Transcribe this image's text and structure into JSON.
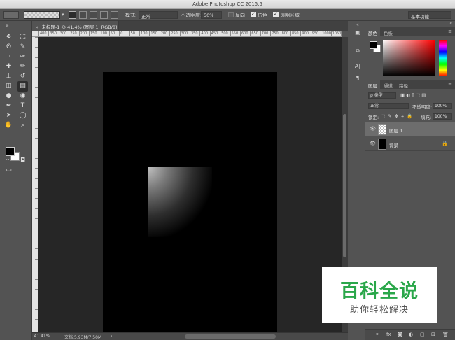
{
  "window": {
    "title": "Adobe Photoshop CC 2015.5"
  },
  "options_bar": {
    "mode_label": "模式:",
    "mode_value": "正常",
    "opacity_label": "不透明度:",
    "opacity_value": "50%",
    "reverse_label": "反向",
    "dither_label": "仿色",
    "transparency_label": "透明区域",
    "workspace_value": "基本功能",
    "reverse_checked": false,
    "dither_checked": true,
    "transparency_checked": true
  },
  "document_tab": {
    "close": "×",
    "label": "未标题-1 @ 41.4% (图层 1, RGB/8) *"
  },
  "ruler_top": {
    "labels": [
      "400",
      "350",
      "300",
      "250",
      "200",
      "150",
      "100",
      "50",
      "0",
      "50",
      "100",
      "150",
      "200",
      "250",
      "300",
      "350",
      "400",
      "450",
      "500",
      "550",
      "600",
      "650",
      "700",
      "750",
      "800",
      "850",
      "900",
      "950",
      "1000",
      "1050",
      "1100"
    ]
  },
  "status_bar": {
    "zoom": "41.41%",
    "doc_info": "文档:5.93M/7.50M",
    "arrow": "›"
  },
  "toolbar": {
    "collapse": "»",
    "tools": [
      {
        "icon": "✥",
        "name": "move-tool-icon"
      },
      {
        "icon": "⬚",
        "name": "marquee-tool-icon"
      },
      {
        "icon": "ʘ",
        "name": "lasso-tool-icon"
      },
      {
        "icon": "✎",
        "name": "quick-selection-tool-icon"
      },
      {
        "icon": "⌗",
        "name": "crop-tool-icon"
      },
      {
        "icon": "✑",
        "name": "eyedropper-tool-icon"
      },
      {
        "icon": "✚",
        "name": "healing-brush-tool-icon"
      },
      {
        "icon": "✏",
        "name": "brush-tool-icon"
      },
      {
        "icon": "⊥",
        "name": "clone-stamp-tool-icon"
      },
      {
        "icon": "↺",
        "name": "history-brush-tool-icon"
      },
      {
        "icon": "◫",
        "name": "eraser-tool-icon"
      },
      {
        "icon": "▤",
        "name": "gradient-tool-icon"
      },
      {
        "icon": "●",
        "name": "blur-tool-icon"
      },
      {
        "icon": "◉",
        "name": "dodge-tool-icon"
      },
      {
        "icon": "✒",
        "name": "pen-tool-icon"
      },
      {
        "icon": "T",
        "name": "type-tool-icon"
      },
      {
        "icon": "➤",
        "name": "path-selection-tool-icon"
      },
      {
        "icon": "◯",
        "name": "shape-tool-icon"
      },
      {
        "icon": "✋",
        "name": "hand-tool-icon"
      },
      {
        "icon": "⌕",
        "name": "zoom-tool-icon"
      },
      {
        "icon": "···",
        "name": "more-tools-icon"
      },
      {
        "icon": "◘",
        "name": "quick-mask-icon"
      },
      {
        "icon": "▭",
        "name": "screen-mode-icon"
      }
    ]
  },
  "mini_dock": {
    "collapse": "«",
    "icons": [
      "▣",
      "⧉",
      "A|",
      "¶"
    ]
  },
  "color_panel": {
    "tabs": [
      "颜色",
      "色板"
    ],
    "menu": "≡",
    "collapse": "«"
  },
  "layers_panel": {
    "tabs": [
      "图层",
      "通道",
      "路径"
    ],
    "menu": "≡",
    "filter_label": "ρ 类型",
    "filter_icons": "▣ ◐ T ⬚ ▤",
    "blend_mode": "正常",
    "opacity_label": "不透明度:",
    "opacity_value": "100%",
    "lock_label": "锁定:",
    "lock_icons": "⬚ ✎ ✥ ⌗ 🔒",
    "fill_label": "填充:",
    "fill_value": "100%",
    "layers": [
      {
        "name": "图层 1",
        "eye": "👁",
        "thumb": "checker",
        "selected": true
      },
      {
        "name": "背景",
        "eye": "👁",
        "thumb": "black",
        "locked": true,
        "lock": "🔒"
      }
    ],
    "bottom_icons": [
      "⚭",
      "fx",
      "◙",
      "◐",
      "▢",
      "⊞",
      "🗑"
    ]
  },
  "watermark": {
    "title": "百科全说",
    "subtitle": "助你轻松解决"
  },
  "colors": {
    "panel_bg": "#535353",
    "workspace_bg": "#262626",
    "document_bg": "#000000",
    "watermark_green": "#2aa74a"
  }
}
